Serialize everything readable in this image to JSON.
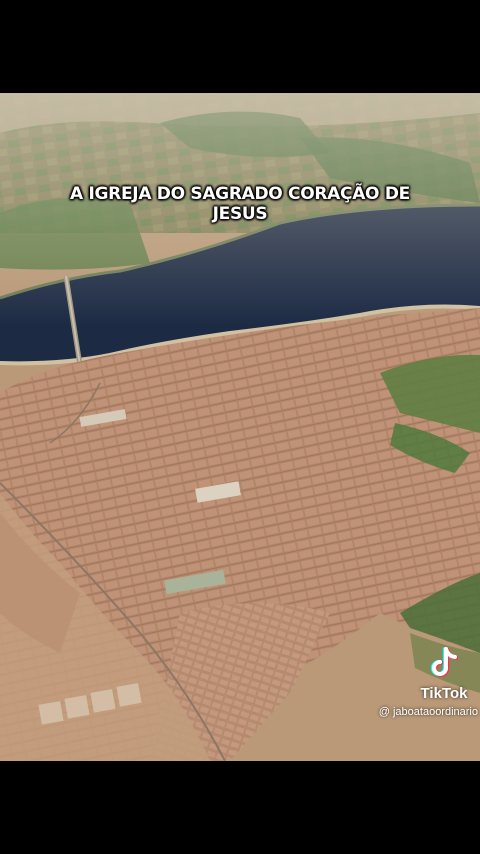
{
  "caption": {
    "line1": "A IGREJA DO SAGRADO CORAÇÃO DE",
    "line2": "JESUS"
  },
  "watermark": {
    "brand": "TikTok",
    "username": "@ jaboataoordinario",
    "icon": "tiktok-note-icon"
  },
  "colors": {
    "letterbox": "#000000",
    "river": "#1c2a44",
    "city": "#b88a70",
    "fields": "#5e7a45",
    "caption_text": "#ffffff"
  }
}
